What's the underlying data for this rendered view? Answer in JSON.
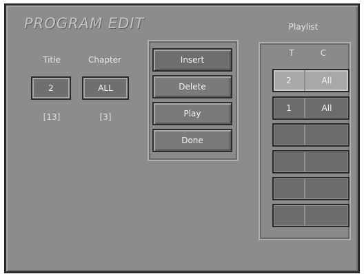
{
  "screen": {
    "title": "PROGRAM EDIT",
    "title_field": {
      "label": "Title",
      "value": "2",
      "range": "[13]"
    },
    "chapter_field": {
      "label": "Chapter",
      "value": "ALL",
      "range": "[3]"
    },
    "buttons": {
      "insert": "Insert",
      "delete": "Delete",
      "play": "Play",
      "done": "Done"
    },
    "playlist": {
      "heading": "Playlist",
      "col_t": "T",
      "col_c": "C",
      "rows": [
        {
          "t": "2",
          "c": "All"
        },
        {
          "t": "1",
          "c": "All"
        },
        {
          "t": "",
          "c": ""
        },
        {
          "t": "",
          "c": ""
        },
        {
          "t": "",
          "c": ""
        },
        {
          "t": "",
          "c": ""
        }
      ]
    }
  }
}
